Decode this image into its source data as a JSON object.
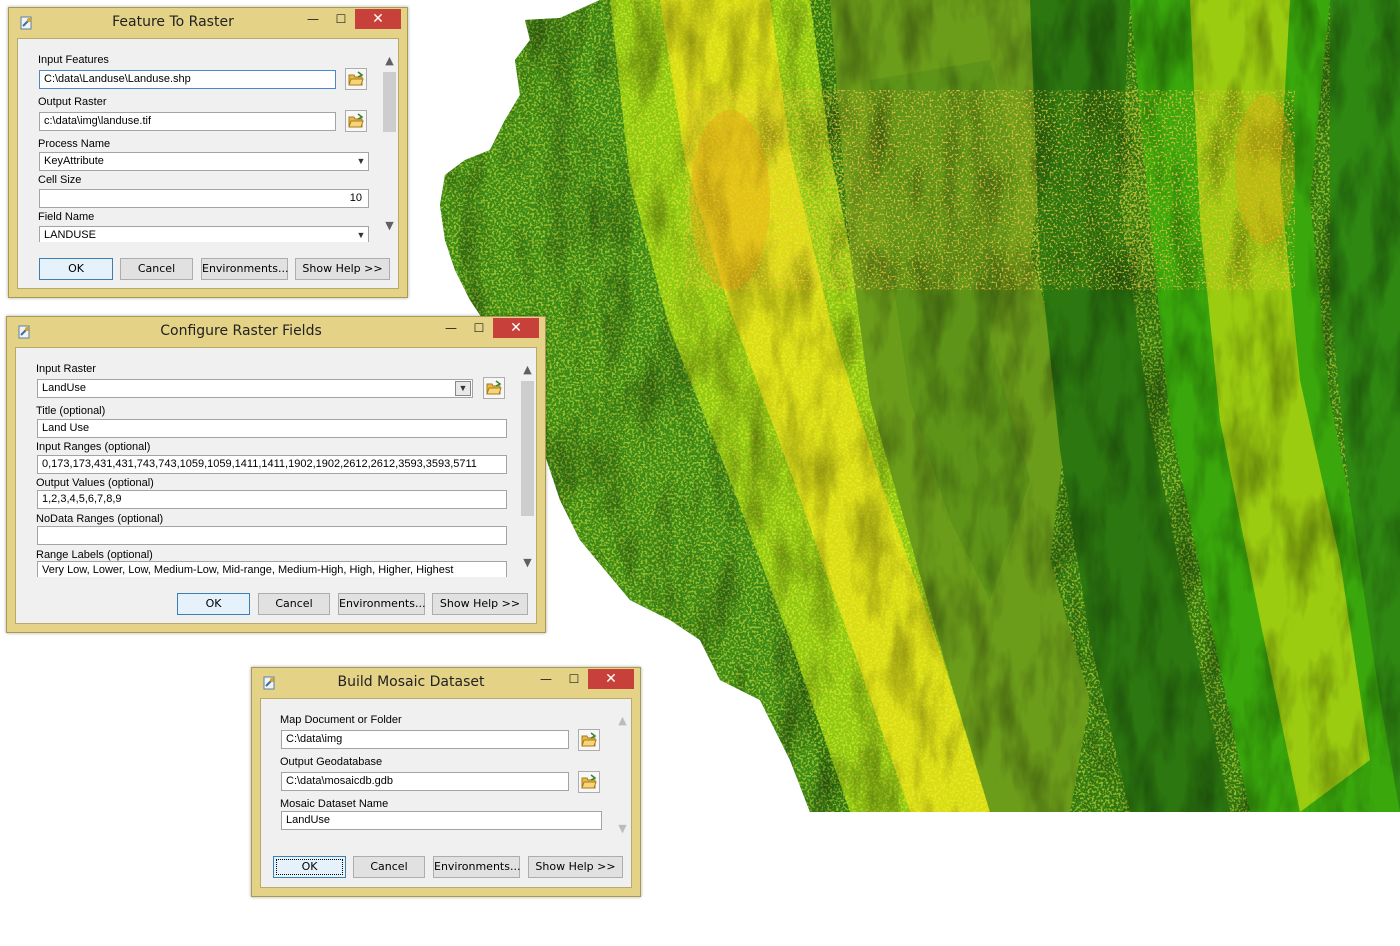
{
  "raster_map": {
    "colors": {
      "dark_green": "#2f7a12",
      "forest_green": "#3d8c16",
      "olive_green": "#6b9c1a",
      "bright_green": "#3aa80c",
      "lime": "#8dc811",
      "yellow": "#e6e00c",
      "orange": "#ec9a10"
    }
  },
  "dialogs": {
    "feature_to_raster": {
      "title": "Feature To Raster",
      "minimize_glyph": "—",
      "maximize_glyph": "☐",
      "close_glyph": "✕",
      "fields": {
        "input_features": {
          "label": "Input Features",
          "value": "C:\\data\\Landuse\\Landuse.shp"
        },
        "output_raster": {
          "label": "Output Raster",
          "value": "c:\\data\\img\\landuse.tif"
        },
        "process_name": {
          "label": "Process Name",
          "value": "KeyAttribute"
        },
        "cell_size": {
          "label": "Cell Size",
          "value": "10"
        },
        "field_name": {
          "label": "Field Name",
          "value": "LANDUSE"
        }
      },
      "buttons": {
        "ok": "OK",
        "cancel": "Cancel",
        "environments": "Environments...",
        "show_help": "Show Help >>"
      }
    },
    "configure_raster_fields": {
      "title": "Configure Raster Fields",
      "minimize_glyph": "—",
      "maximize_glyph": "☐",
      "close_glyph": "✕",
      "fields": {
        "input_raster": {
          "label": "Input Raster",
          "value": "LandUse"
        },
        "title": {
          "label": "Title (optional)",
          "value": "Land Use"
        },
        "input_ranges": {
          "label": "Input Ranges (optional)",
          "value": "0,173,173,431,431,743,743,1059,1059,1411,1411,1902,1902,2612,2612,3593,3593,5711"
        },
        "output_values": {
          "label": "Output Values (optional)",
          "value": "1,2,3,4,5,6,7,8,9"
        },
        "nodata_ranges": {
          "label": "NoData Ranges (optional)",
          "value": ""
        },
        "range_labels": {
          "label": "Range Labels (optional)",
          "value": "Very Low, Lower, Low, Medium-Low, Mid-range, Medium-High, High, Higher, Highest"
        }
      },
      "buttons": {
        "ok": "OK",
        "cancel": "Cancel",
        "environments": "Environments...",
        "show_help": "Show Help >>"
      }
    },
    "build_mosaic_dataset": {
      "title": "Build Mosaic Dataset",
      "minimize_glyph": "—",
      "maximize_glyph": "☐",
      "close_glyph": "✕",
      "fields": {
        "map_document": {
          "label": "Map Document or Folder",
          "value": "C:\\data\\img"
        },
        "output_geodatabase": {
          "label": "Output Geodatabase",
          "value": "C:\\data\\mosaicdb.gdb"
        },
        "mosaic_dataset_name": {
          "label": "Mosaic Dataset Name",
          "value": "LandUse"
        }
      },
      "buttons": {
        "ok": "OK",
        "cancel": "Cancel",
        "environments": "Environments...",
        "show_help": "Show Help >>"
      }
    }
  },
  "icons": {
    "app": "arcgis-tool-icon",
    "browse": "open-folder-icon",
    "scroll_up": "▲",
    "scroll_down": "▼",
    "dropdown": "▼"
  }
}
